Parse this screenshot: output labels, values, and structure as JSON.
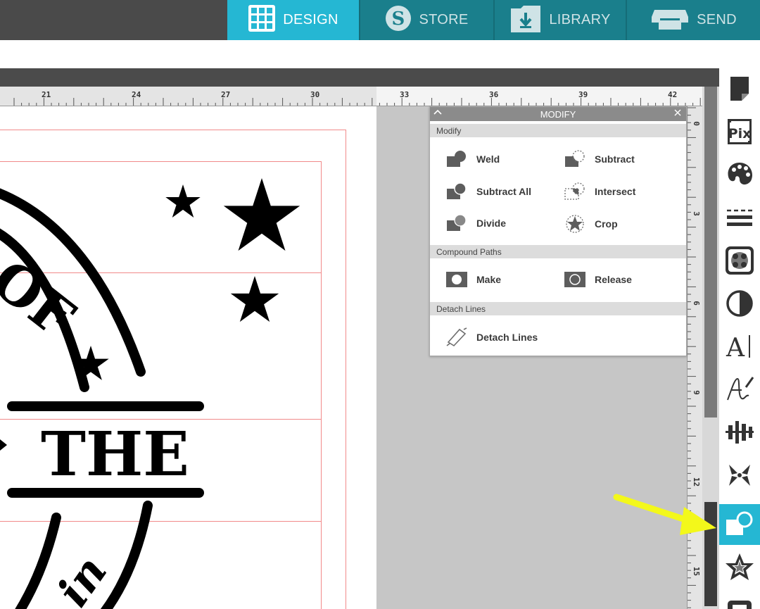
{
  "nav": {
    "tabs": [
      {
        "label": "DESIGN",
        "icon": "grid-icon",
        "active": true
      },
      {
        "label": "STORE",
        "icon": "silhouette-s-icon",
        "active": false
      },
      {
        "label": "LIBRARY",
        "icon": "download-folder-icon",
        "active": false
      },
      {
        "label": "SEND",
        "icon": "cutter-icon",
        "active": false
      }
    ],
    "active_color": "#25b7d3",
    "bar_color": "#1a7f8c"
  },
  "ruler": {
    "horizontal_ticks": [
      "21",
      "24",
      "27",
      "30",
      "33",
      "36",
      "39",
      "42"
    ],
    "vertical_ticks": [
      "0",
      "3",
      "6",
      "9",
      "12",
      "15"
    ]
  },
  "artwork": {
    "main_word": "THE",
    "arc_top": "OF",
    "arc_bottom": "in"
  },
  "modify_panel": {
    "title": "MODIFY",
    "sections": {
      "modify": {
        "header": "Modify",
        "weld": "Weld",
        "subtract": "Subtract",
        "subtract_all": "Subtract All",
        "intersect": "Intersect",
        "divide": "Divide",
        "crop": "Crop"
      },
      "compound": {
        "header": "Compound Paths",
        "make": "Make",
        "release": "Release"
      },
      "detach": {
        "header": "Detach Lines",
        "detach_lines": "Detach Lines"
      }
    }
  },
  "right_toolbar": {
    "items": [
      "page-setup-icon",
      "pixscan-icon",
      "fill-color-icon",
      "line-style-icon",
      "trace-icon",
      "transparency-icon",
      "text-style-icon",
      "sketch-icon",
      "align-icon",
      "replicate-icon",
      "modify-icon",
      "offset-icon",
      "library-icon"
    ],
    "pix_label": "Pix",
    "active": "modify-icon"
  },
  "annotation": {
    "arrow_color": "#f3f81a"
  }
}
